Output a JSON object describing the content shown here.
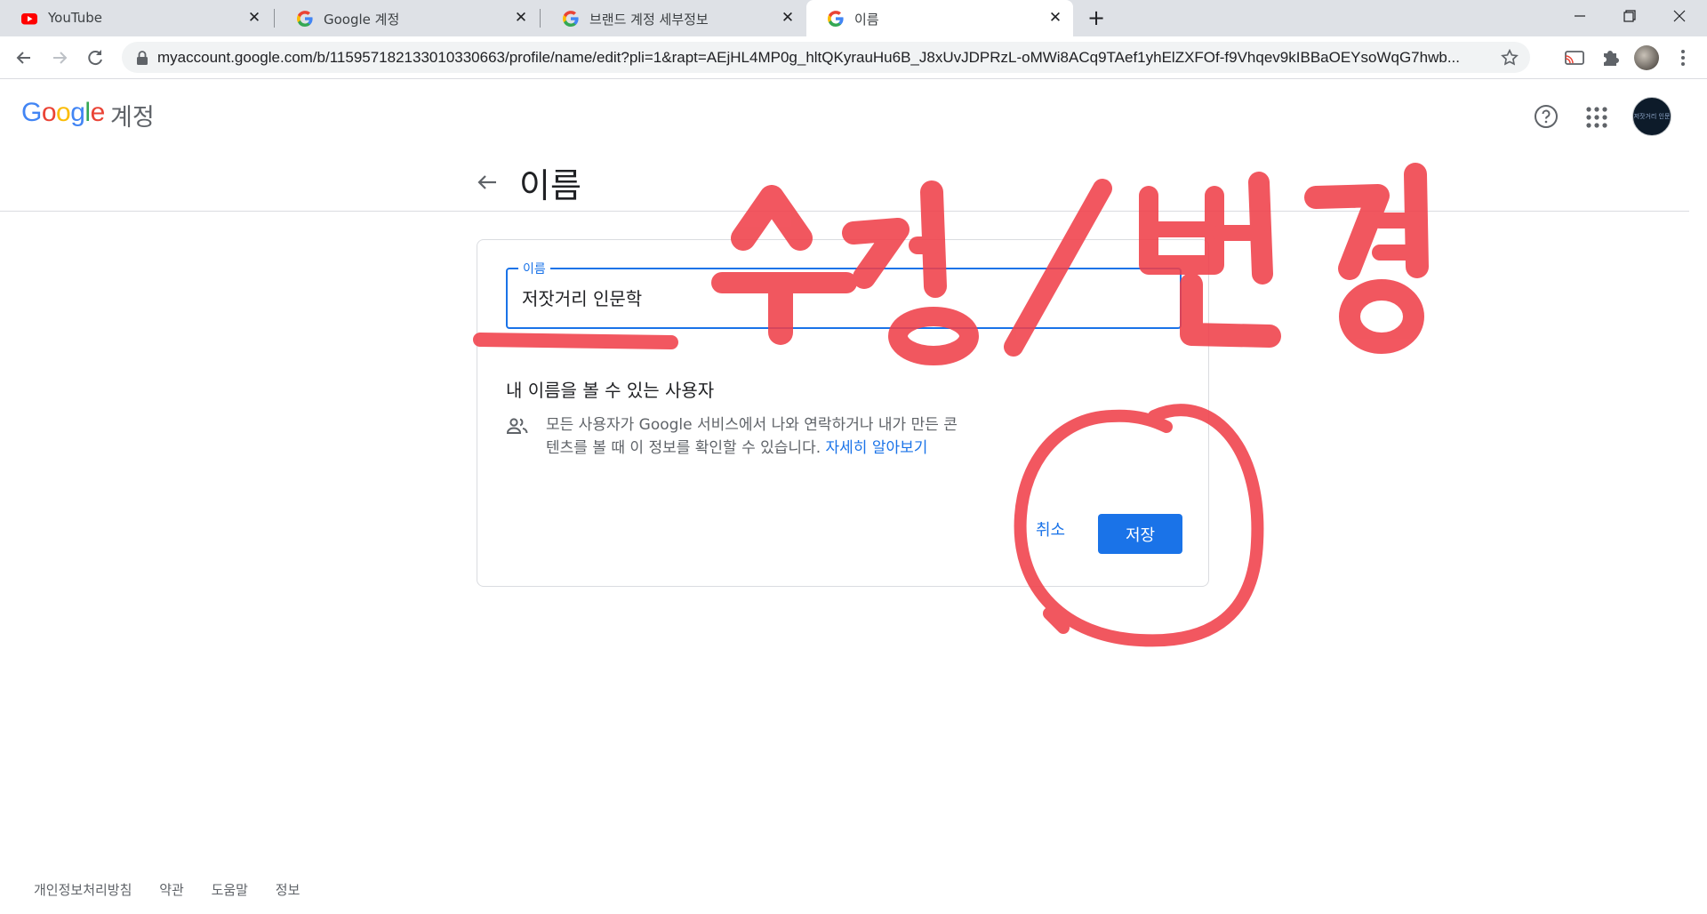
{
  "browser": {
    "tabs": [
      {
        "title": "YouTube",
        "icon": "youtube-icon",
        "active": false
      },
      {
        "title": "Google 계정",
        "icon": "google-g-icon",
        "active": false
      },
      {
        "title": "브랜드 계정 세부정보",
        "icon": "google-g-icon",
        "active": false
      },
      {
        "title": "이름",
        "icon": "google-g-icon",
        "active": true
      }
    ],
    "url": "myaccount.google.com/b/115957182133010330663/profile/name/edit?pli=1&rapt=AEjHL4MP0g_hltQKyrauHu6B_J8xUvJDPRzL-oMWi8ACq9TAef1yhElZXFOf-f9Vhqev9kIBBaOEYsoWqG7hwb...",
    "close_glyph": "✕",
    "new_tab_glyph": "+"
  },
  "header": {
    "logo_letters": [
      "G",
      "o",
      "o",
      "g",
      "l",
      "e"
    ],
    "product": "계정",
    "avatar_text": "저잣거리 인문학"
  },
  "page": {
    "title": "이름"
  },
  "form": {
    "field_label": "이름",
    "field_value": "저잣거리 인문학",
    "who_heading": "내 이름을 볼 수 있는 사용자",
    "who_desc": "모든 사용자가 Google 서비스에서 나와 연락하거나 내가 만든 콘텐츠를 볼 때 이 정보를 확인할 수 있습니다.",
    "learn_more": "자세히 알아보기",
    "cancel_label": "취소",
    "save_label": "저장"
  },
  "footer": {
    "links": [
      "개인정보처리방침",
      "약관",
      "도움말",
      "정보"
    ]
  },
  "annotation": {
    "handwritten_text": "수정/변경",
    "color": "#f0404a"
  },
  "colors": {
    "accent": "#1a73e8",
    "tab_strip": "#dee1e6"
  }
}
